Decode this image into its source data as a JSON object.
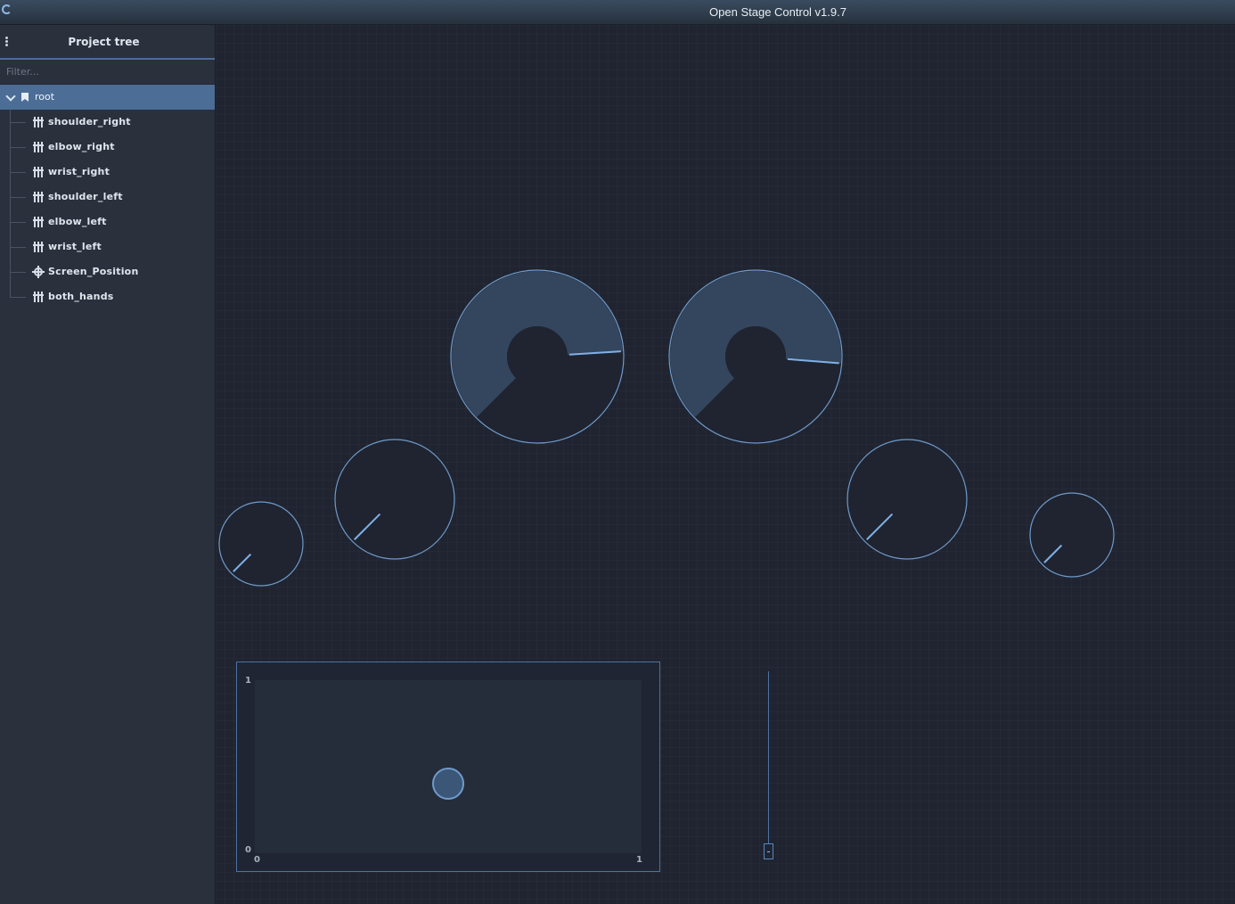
{
  "window": {
    "title": "Open Stage Control v1.9.7"
  },
  "sidebar": {
    "title": "Project tree",
    "filter_placeholder": "Filter...",
    "root_label": "root",
    "items": [
      {
        "label": "shoulder_right",
        "icon": "fader-icon"
      },
      {
        "label": "elbow_right",
        "icon": "fader-icon"
      },
      {
        "label": "wrist_right",
        "icon": "fader-icon"
      },
      {
        "label": "shoulder_left",
        "icon": "fader-icon"
      },
      {
        "label": "elbow_left",
        "icon": "fader-icon"
      },
      {
        "label": "wrist_left",
        "icon": "fader-icon"
      },
      {
        "label": "Screen_Position",
        "icon": "crosshair-icon"
      },
      {
        "label": "both_hands",
        "icon": "fader-icon"
      }
    ]
  },
  "colors": {
    "accent": "#4b6d96",
    "widget_stroke": "#6f9acb",
    "background": "#1f2430"
  },
  "widgets": {
    "knobs": [
      {
        "name": "knob-large-left",
        "value": 0.82
      },
      {
        "name": "knob-large-right",
        "value": 0.85
      },
      {
        "name": "knob-medium-left",
        "value": 0.0
      },
      {
        "name": "knob-medium-right",
        "value": 0.0
      },
      {
        "name": "knob-small-left",
        "value": 0.0
      },
      {
        "name": "knob-small-right",
        "value": 0.0
      }
    ],
    "xy_pad": {
      "x_min_label": "0",
      "x_max_label": "1",
      "y_min_label": "0",
      "y_max_label": "1",
      "x_value": 0.5,
      "y_value": 0.3
    },
    "fader": {
      "value": 0.0
    }
  }
}
